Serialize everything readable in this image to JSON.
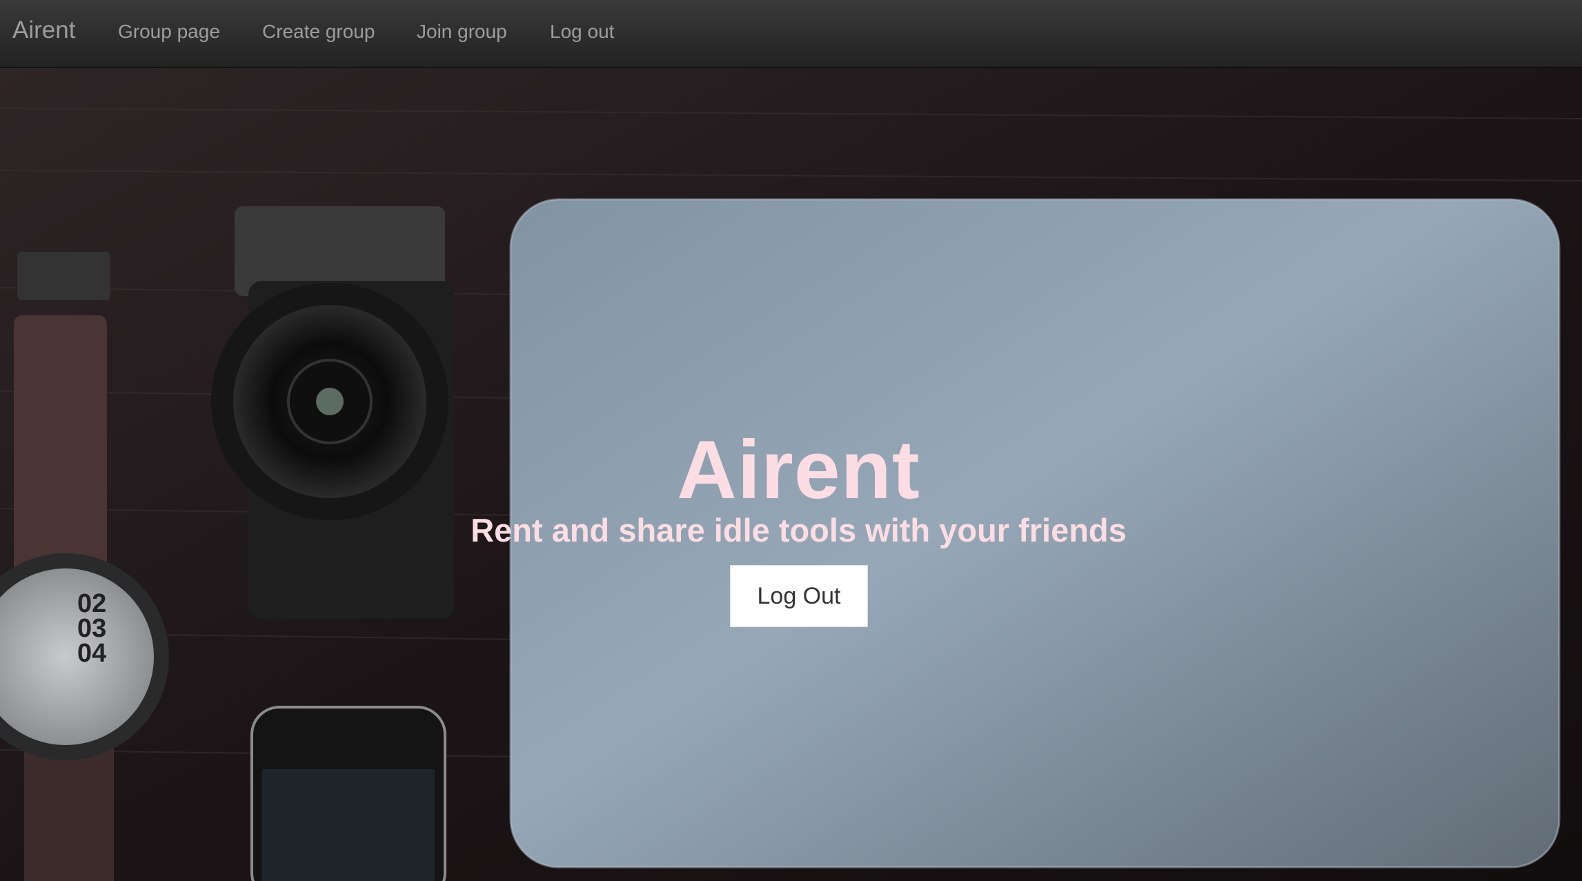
{
  "navbar": {
    "brand": "Airent",
    "links": [
      "Group page",
      "Create group",
      "Join group",
      "Log out"
    ]
  },
  "hero": {
    "title": "Airent",
    "subtitle": "Rent and share idle tools with your friends",
    "button_label": "Log Out"
  },
  "colors": {
    "navbar_bg": "#2b2b2b",
    "nav_text": "#9d9d9d",
    "hero_text": "#fcdde3",
    "button_bg": "#ffffff"
  },
  "icons": [
    "wristwatch-photo",
    "camera-photo",
    "smartphone-photo",
    "laptop-photo"
  ]
}
